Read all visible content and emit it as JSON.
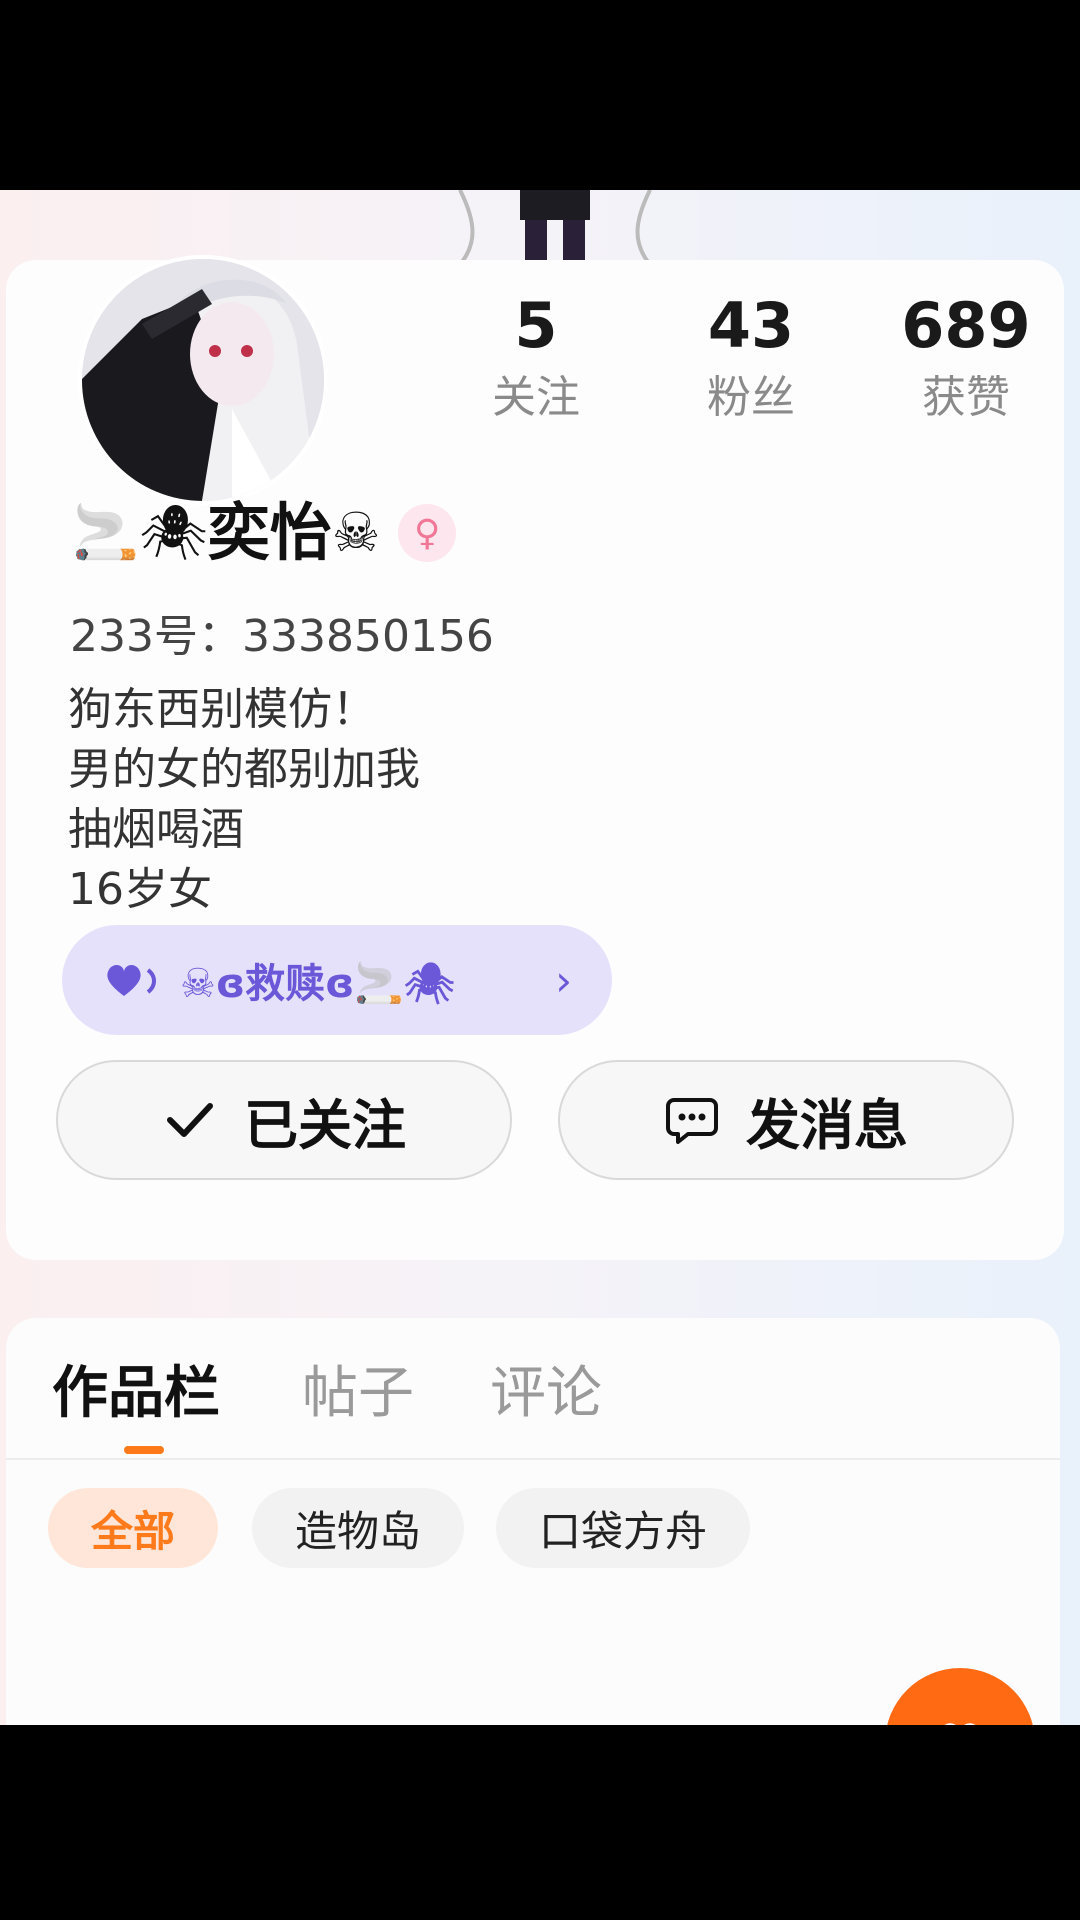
{
  "profile": {
    "stats": [
      {
        "count": "5",
        "label": "关注"
      },
      {
        "count": "43",
        "label": "粉丝"
      },
      {
        "count": "689",
        "label": "获赞"
      }
    ],
    "name_prefix": "🚬🕷",
    "name": "奕怡",
    "name_suffix": "☠",
    "gender_symbol": "♀",
    "id_line": "233号：333850156",
    "bio": [
      "狗东西别模仿！",
      "男的女的都别加我",
      "抽烟喝酒",
      "16岁女"
    ],
    "signature": "☠ɞ救赎ɞ🚬🕷",
    "signature_chevron": "›"
  },
  "actions": {
    "follow_label": "已关注",
    "message_label": "发消息"
  },
  "tabs": [
    {
      "label": "作品栏"
    },
    {
      "label": "帖子"
    },
    {
      "label": "评论"
    }
  ],
  "filters": [
    {
      "label": "全部"
    },
    {
      "label": "造物岛"
    },
    {
      "label": "口袋方舟"
    }
  ],
  "colors": {
    "accent": "#ff7a1a",
    "signature_bg": "#e6e1fb",
    "signature_text": "#6b58d9"
  }
}
